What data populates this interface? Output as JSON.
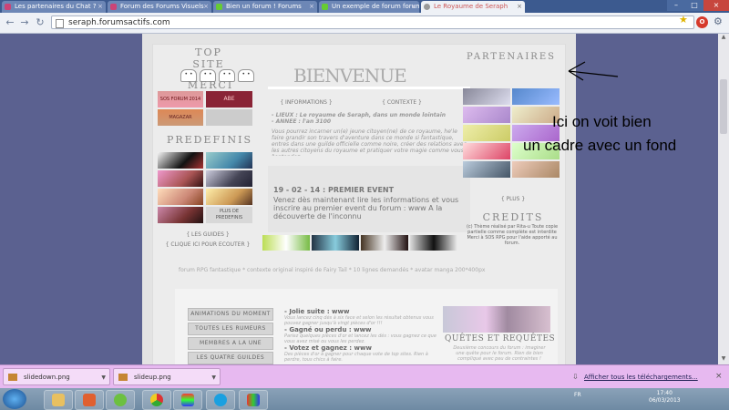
{
  "browser": {
    "tabs": [
      {
        "label": "Les partenaires du Chat ?"
      },
      {
        "label": "Forum des Forums Visuels"
      },
      {
        "label": "Bien un forum ! Forums"
      },
      {
        "label": "Un exemple de forum forum"
      },
      {
        "label": "Le Royaume de Seraph"
      }
    ],
    "url": "seraph.forumsactifs.com"
  },
  "site": {
    "top_site": "TOP SITE",
    "merci": "MERCI",
    "predefinis": "PREDEFINIS",
    "bienvenue": "BIENVENUE",
    "partenaires": "PARTENAIRES",
    "credits": "CREDITS",
    "informations_link": "{ INFORMATIONS }",
    "contexte_link": "{ CONTEXTE }",
    "lieux": "- LIEUX : Le royaume de Seraph, dans un monde lointain",
    "annee": "- ANNEE : l'an 3100",
    "intro": "Vous pourrez incarner un(e) jeune citoyen(ne) de ce royaume, he'le faire grandir son travers d'aventure dans ce monde si fantastique, entres dans une guilde officielle comme noire, créer des relations avec les autres citoyens du royaume et pratiquer votre magie comme vous l'entendez...",
    "news_title": "19 - 02 - 14 : PREMIER EVENT",
    "news_body": "Venez dès maintenant lire les informations et vous inscrire au premier event du forum : www A la découverte de l'inconnu",
    "plus_predef": "PLUS DE PREDEFINIS",
    "guides_link": "{ LES GUIDES }",
    "ecouter_link": "{ CLIQUE ICI POUR ECOUTER }",
    "plus_link": "{ PLUS }",
    "credits_text": "(c) Thème réalisé par Rita-u Toute copie partielle comme complète est interdite Merci à SOS RPG pour l'aide apporté au forum.",
    "footer": "forum RPG fantastique * contexte original inspiré de Fairy Tail * 10 lignes demandés * avatar manga 200*400px",
    "merci_badges": [
      "SOS FORUM 2014",
      "ABE",
      "MAGAZAR",
      ""
    ],
    "guide_buttons": [
      "ANIMATIONS DU MOMENT",
      "TOUTES LES RUMEURS",
      "MEMBRES A LA UNE",
      "LES QUATRE GUILDES"
    ],
    "games": [
      {
        "title": "- Jolie suite : www",
        "text": "Vous lancez cinq dés à six face et selon les résultat obtenus vous pouvez gagner jusqu'à vingt pièces d'or !!!"
      },
      {
        "title": "- Gagné ou perdu : www",
        "text": "Pariez quelques pièces d'or et lancez les dés : vous gagnez ce que vous avez misé ou vous les perdez."
      },
      {
        "title": "- Votez et gagnez : www",
        "text": "Des pièces d'or à gagner pour chaque vote de top sites. Rien à perdre, tous chics à faire."
      }
    ],
    "quetes_title": "QUÊTES ET REQUÊTES",
    "quetes_text": "Deuxième concours du forum : imaginer une quête pour le forum. Rien de bien compliqué avec peu de contraintes !"
  },
  "annotation": {
    "line1": "Ici on voit bien",
    "line2": "un cadre avec un fond"
  },
  "downloads": {
    "items": [
      "slidedown.png",
      "slideup.png"
    ],
    "show_all": "Afficher tous les téléchargements..."
  },
  "taskbar": {
    "lang": "FR",
    "time": "17:40",
    "date": "06/03/2013"
  }
}
